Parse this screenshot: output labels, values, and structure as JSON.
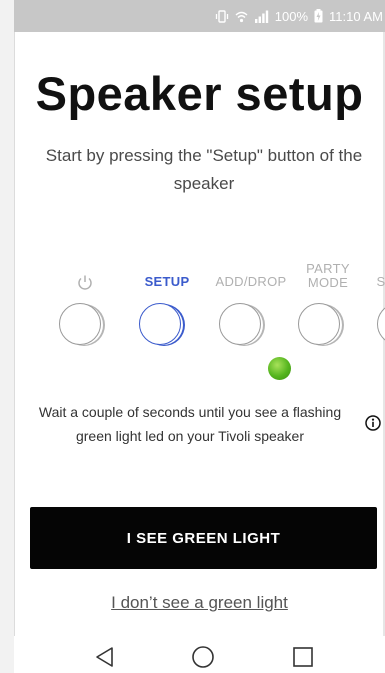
{
  "status_bar": {
    "battery": "100%",
    "time": "11:10 AM"
  },
  "page": {
    "title": "Speaker setup",
    "subtitle": "Start by pressing the \"Setup\" button of the speaker"
  },
  "speaker_buttons": [
    {
      "label": "",
      "icon": "power-icon",
      "active": false
    },
    {
      "label": "SETUP",
      "active": true
    },
    {
      "label": "ADD/DROP",
      "active": false
    },
    {
      "label": "PARTY MODE",
      "active": false
    },
    {
      "label": "S",
      "active": false
    }
  ],
  "led": {
    "color": "#55b51e"
  },
  "instructions": {
    "wait_text": "Wait a couple of seconds until you see a flashing green light led on your Tivoli speaker"
  },
  "actions": {
    "primary_label": "I SEE GREEN LIGHT",
    "secondary_label": "I don’t see a green light"
  },
  "nav": {
    "back_icon": "back-triangle-icon",
    "home_icon": "home-circle-icon",
    "recents_icon": "recents-square-icon"
  },
  "colors": {
    "accent": "#3b5bcc",
    "cta_background": "#050505",
    "status_bar": "#c7c7c7"
  }
}
